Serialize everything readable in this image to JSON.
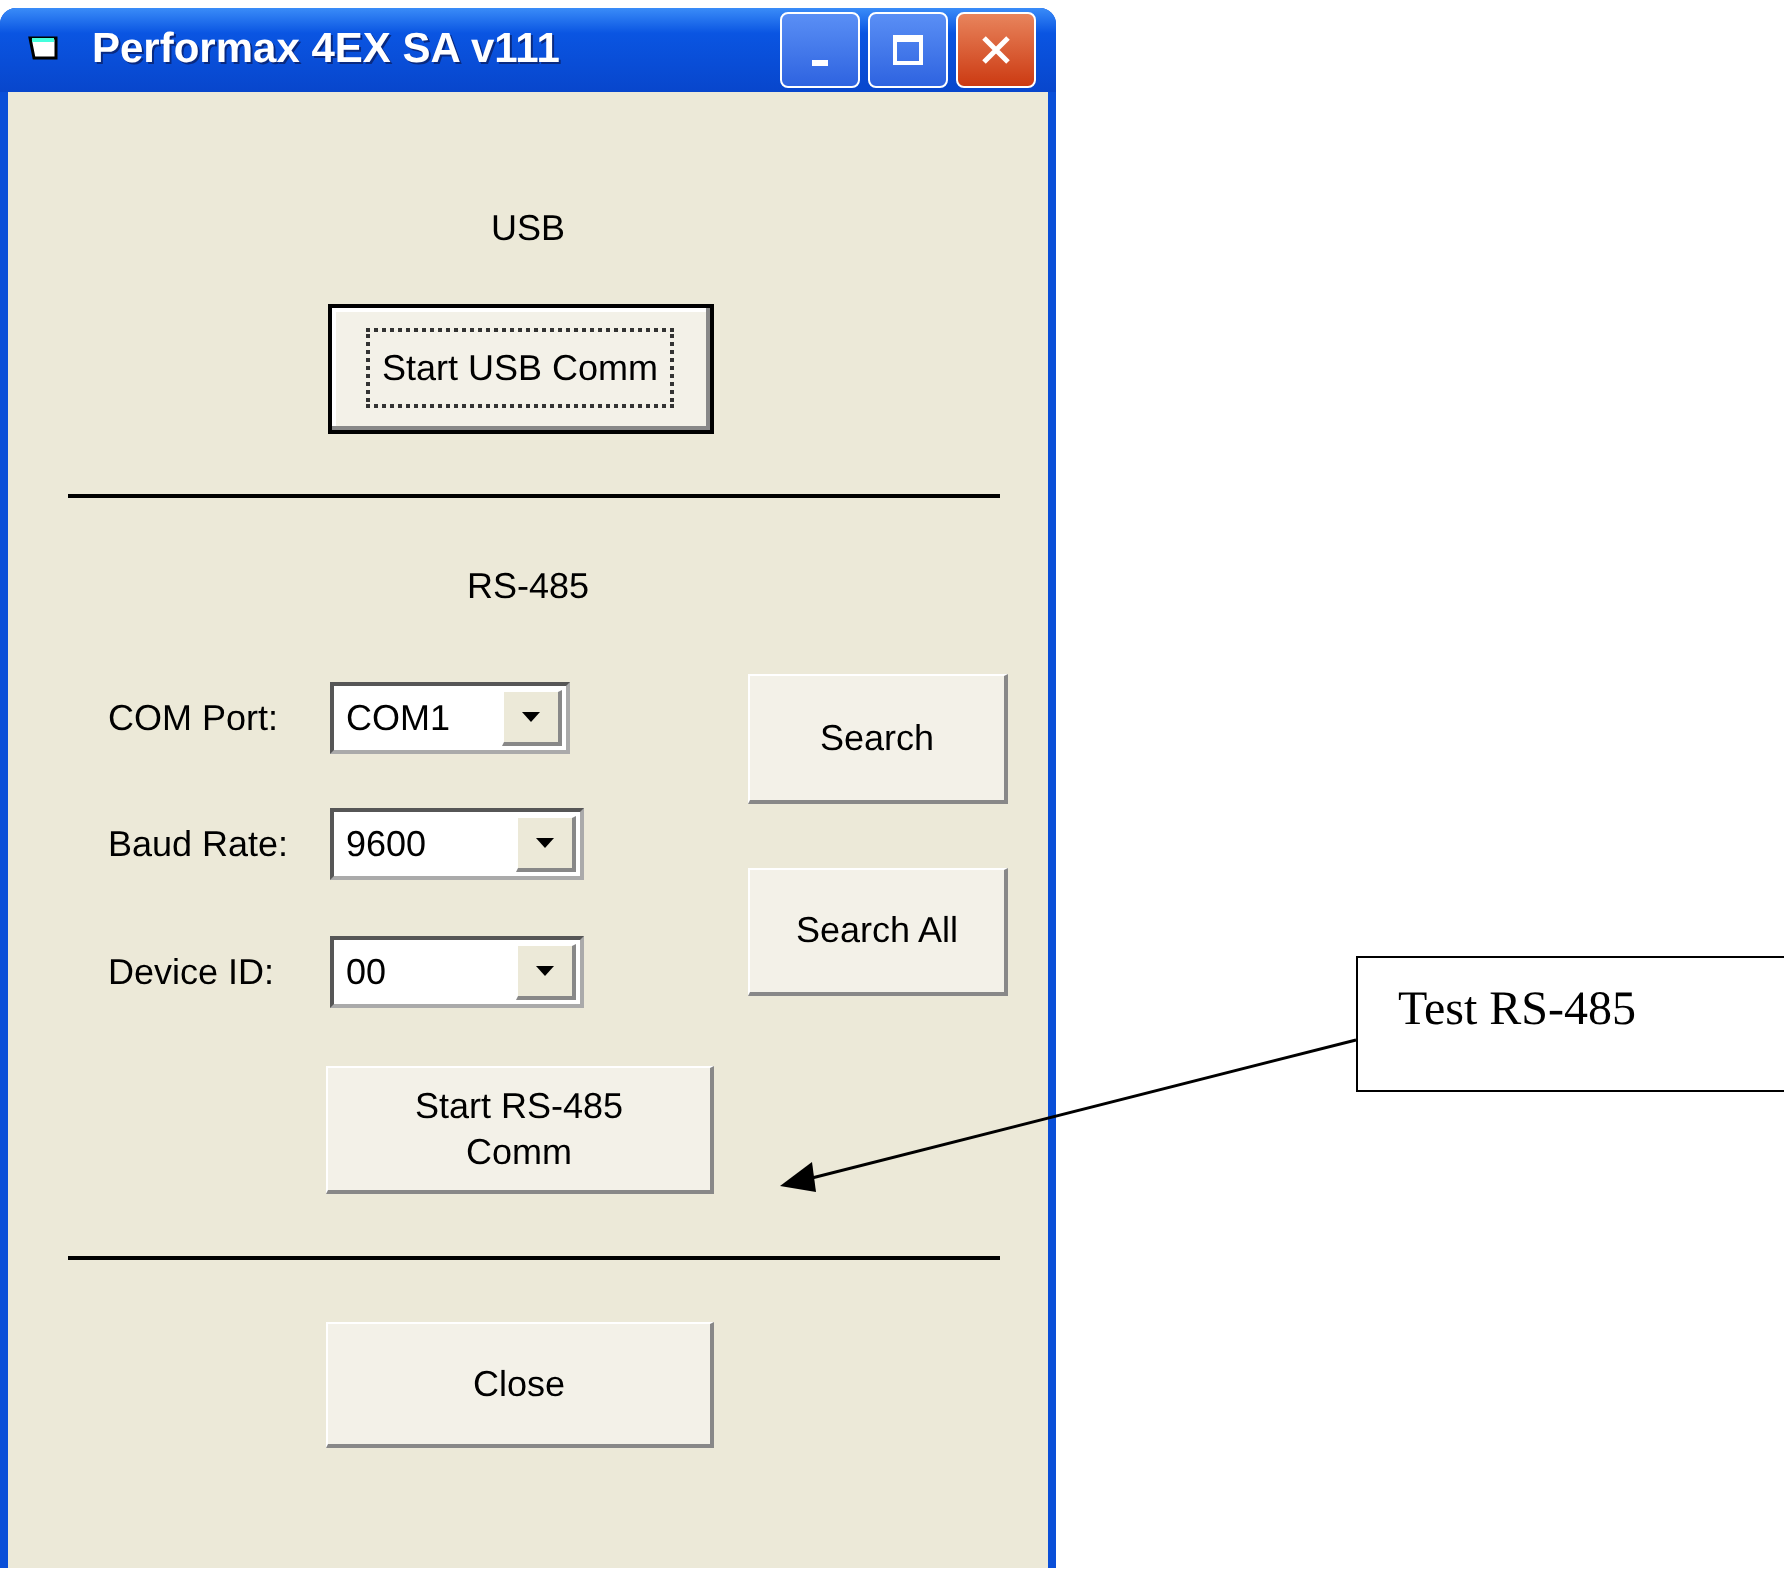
{
  "window": {
    "title": "Performax 4EX SA v111"
  },
  "usb": {
    "heading": "USB",
    "button": {
      "label": "Start USB Comm",
      "default": true
    }
  },
  "rs485": {
    "heading": "RS-485",
    "fields": [
      {
        "label": "COM Port:",
        "value": "COM1"
      },
      {
        "label": "Baud Rate:",
        "value": "9600"
      },
      {
        "label": "Device ID:",
        "value": "00"
      }
    ],
    "buttons": [
      "Search",
      "Search All"
    ],
    "start_button": {
      "label": "Start RS-485\nComm",
      "default": false
    }
  },
  "close_button": "Close",
  "callout": {
    "text": "Test RS-485"
  }
}
